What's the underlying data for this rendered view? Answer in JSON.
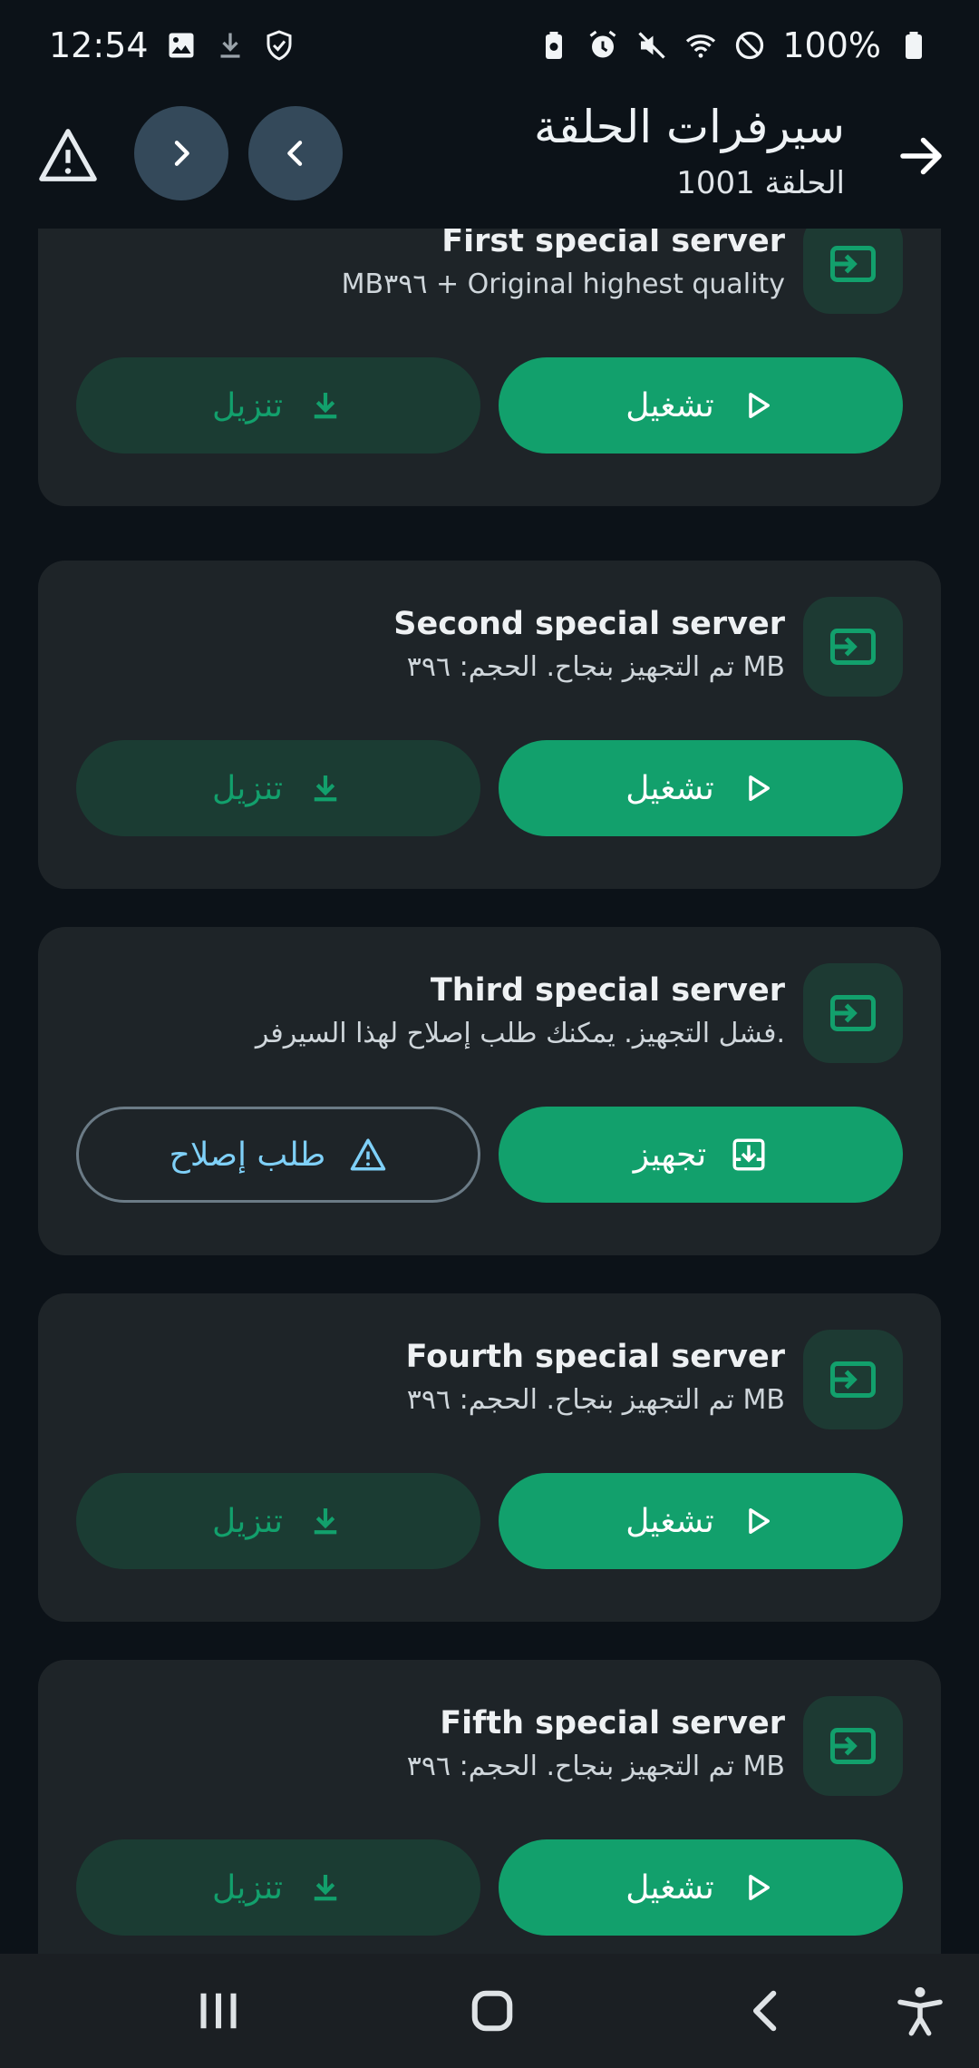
{
  "status": {
    "time": "12:54",
    "battery": "100%"
  },
  "header": {
    "title": "سيرفرات الحلقة",
    "subtitle": "الحلقة 1001"
  },
  "servers": [
    {
      "title": "First special server",
      "subtitle": "MB٣٩٦ + Original highest quality",
      "primary_label": "تشغيل",
      "primary_icon": "play-icon",
      "secondary_label": "تنزيل",
      "secondary_icon": "download-icon",
      "secondary_style": "filled"
    },
    {
      "title": "Second special server",
      "subtitle": "تم التجهيز بنجاح. الحجم: ٣٩٦ MB",
      "primary_label": "تشغيل",
      "primary_icon": "play-icon",
      "secondary_label": "تنزيل",
      "secondary_icon": "download-icon",
      "secondary_style": "filled"
    },
    {
      "title": "Third special server",
      "subtitle": "فشل التجهيز. يمكنك طلب إصلاح لهذا السيرفر.",
      "primary_label": "تجهيز",
      "primary_icon": "prepare-icon",
      "secondary_label": "طلب إصلاح",
      "secondary_icon": "warning-icon",
      "secondary_style": "outline"
    },
    {
      "title": "Fourth special server",
      "subtitle": "تم التجهيز بنجاح. الحجم: ٣٩٦ MB",
      "primary_label": "تشغيل",
      "primary_icon": "play-icon",
      "secondary_label": "تنزيل",
      "secondary_icon": "download-icon",
      "secondary_style": "filled"
    },
    {
      "title": "Fifth special server",
      "subtitle": "تم التجهيز بنجاح. الحجم: ٣٩٦ MB",
      "primary_label": "تشغيل",
      "primary_icon": "play-icon",
      "secondary_label": "تنزيل",
      "secondary_icon": "download-icon",
      "secondary_style": "filled"
    }
  ],
  "colors": {
    "background": "#0c1218",
    "card": "#1e2428",
    "accent": "#12a06c",
    "accent_dark": "#1b3c33",
    "link_blue": "#7fd0f8"
  }
}
